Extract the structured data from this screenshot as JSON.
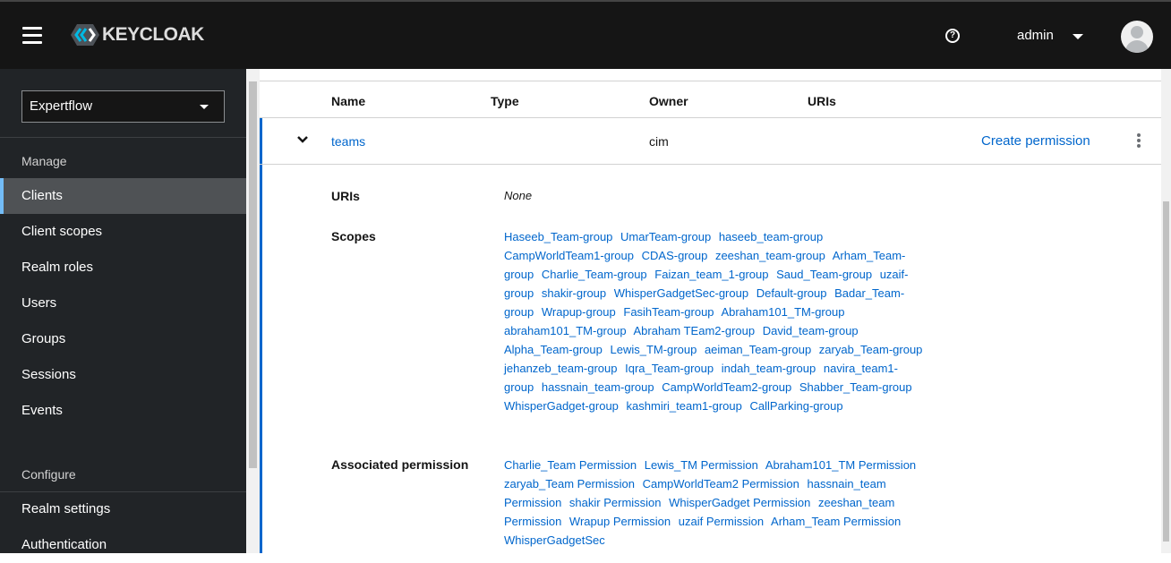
{
  "header": {
    "brand": "KEYCLOAK",
    "user": "admin"
  },
  "sidebar": {
    "realm": "Expertflow",
    "sections": {
      "manage": "Manage",
      "configure": "Configure"
    },
    "items": [
      "Clients",
      "Client scopes",
      "Realm roles",
      "Users",
      "Groups",
      "Sessions",
      "Events"
    ],
    "config_items": [
      "Realm settings",
      "Authentication"
    ]
  },
  "table": {
    "columns": [
      "Name",
      "Type",
      "Owner",
      "URIs"
    ],
    "row": {
      "name": "teams",
      "owner": "cim",
      "action": "Create permission"
    }
  },
  "details": {
    "uris_label": "URIs",
    "uris_value": "None",
    "scopes_label": "Scopes",
    "perm_label": "Associated permission",
    "scopes": [
      "Haseeb_Team-group",
      "UmarTeam-group",
      "haseeb_team-group",
      "CampWorldTeam1-group",
      "CDAS-group",
      "zeeshan_team-group",
      "Arham_Team-group",
      "Charlie_Team-group",
      "Faizan_team_1-group",
      "Saud_Team-group",
      "uzaif-group",
      "shakir-group",
      "WhisperGadgetSec-group",
      "Default-group",
      "Badar_Team-group",
      "Wrapup-group",
      "FasihTeam-group",
      "Abraham101_TM-group",
      "abraham101_TM-group",
      "Abraham TEam2-group",
      "David_team-group",
      "Alpha_Team-group",
      "Lewis_TM-group",
      "aeiman_Team-group",
      "zaryab_Team-group",
      "jehanzeb_team-group",
      "Iqra_Team-group",
      "indah_team-group",
      "navira_team1-group",
      "hassnain_team-group",
      "CampWorldTeam2-group",
      "Shabber_Team-group",
      "WhisperGadget-group",
      "kashmiri_team1-group",
      "CallParking-group"
    ],
    "permissions": [
      "Charlie_Team Permission",
      "Lewis_TM Permission",
      "Abraham101_TM Permission",
      "zaryab_Team Permission",
      "CampWorldTeam2 Permission",
      "hassnain_team Permission",
      "shakir Permission",
      "WhisperGadget Permission",
      "zeeshan_team Permission",
      "Wrapup Permission",
      "uzaif Permission",
      "Arham_Team Permission",
      "WhisperGadgetSec"
    ]
  }
}
